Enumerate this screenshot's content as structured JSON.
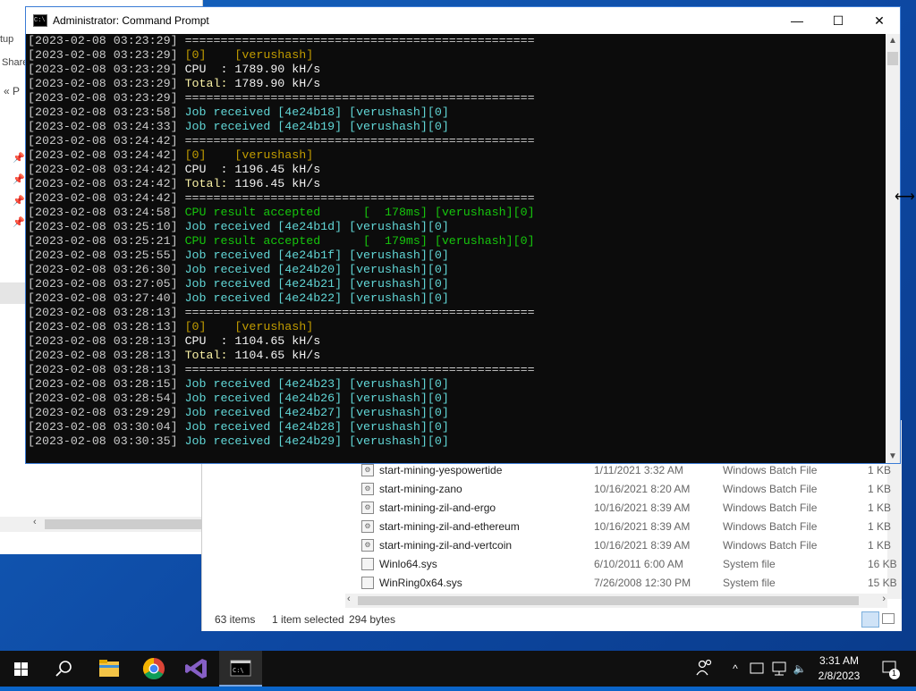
{
  "back_window": {
    "labels": [
      "tup",
      "Share",
      "P"
    ]
  },
  "cmd": {
    "title": "Administrator:  Command Prompt",
    "lines": [
      [
        {
          "t": "[2023-02-08 03:23:29] ",
          "c": "#cccccc"
        },
        {
          "t": "=================================================",
          "c": "#cccccc"
        }
      ],
      [
        {
          "t": "[2023-02-08 03:23:29] ",
          "c": "#cccccc"
        },
        {
          "t": "[0]    [verushash]",
          "c": "#c19c00"
        }
      ],
      [
        {
          "t": "[2023-02-08 03:23:29] ",
          "c": "#cccccc"
        },
        {
          "t": "CPU  : 1789.90 kH/s",
          "c": "#f2f2f2"
        }
      ],
      [
        {
          "t": "[2023-02-08 03:23:29] ",
          "c": "#cccccc"
        },
        {
          "t": "Total: ",
          "c": "#f9f1a5"
        },
        {
          "t": "1789.90 kH/s",
          "c": "#f2f2f2"
        }
      ],
      [
        {
          "t": "[2023-02-08 03:23:29] ",
          "c": "#cccccc"
        },
        {
          "t": "=================================================",
          "c": "#cccccc"
        }
      ],
      [
        {
          "t": "[2023-02-08 03:23:58] ",
          "c": "#cccccc"
        },
        {
          "t": "Job received [4e24b18] [verushash][0]",
          "c": "#61d6d6"
        }
      ],
      [
        {
          "t": "[2023-02-08 03:24:33] ",
          "c": "#cccccc"
        },
        {
          "t": "Job received [4e24b19] [verushash][0]",
          "c": "#61d6d6"
        }
      ],
      [
        {
          "t": "[2023-02-08 03:24:42] ",
          "c": "#cccccc"
        },
        {
          "t": "=================================================",
          "c": "#cccccc"
        }
      ],
      [
        {
          "t": "[2023-02-08 03:24:42] ",
          "c": "#cccccc"
        },
        {
          "t": "[0]    [verushash]",
          "c": "#c19c00"
        }
      ],
      [
        {
          "t": "[2023-02-08 03:24:42] ",
          "c": "#cccccc"
        },
        {
          "t": "CPU  : 1196.45 kH/s",
          "c": "#f2f2f2"
        }
      ],
      [
        {
          "t": "[2023-02-08 03:24:42] ",
          "c": "#cccccc"
        },
        {
          "t": "Total: ",
          "c": "#f9f1a5"
        },
        {
          "t": "1196.45 kH/s",
          "c": "#f2f2f2"
        }
      ],
      [
        {
          "t": "[2023-02-08 03:24:42] ",
          "c": "#cccccc"
        },
        {
          "t": "=================================================",
          "c": "#cccccc"
        }
      ],
      [
        {
          "t": "[2023-02-08 03:24:58] ",
          "c": "#cccccc"
        },
        {
          "t": "CPU result accepted      [  178ms] [verushash][0]",
          "c": "#16c60c"
        }
      ],
      [
        {
          "t": "[2023-02-08 03:25:10] ",
          "c": "#cccccc"
        },
        {
          "t": "Job received [4e24b1d] [verushash][0]",
          "c": "#61d6d6"
        }
      ],
      [
        {
          "t": "[2023-02-08 03:25:21] ",
          "c": "#cccccc"
        },
        {
          "t": "CPU result accepted      [  179ms] [verushash][0]",
          "c": "#16c60c"
        }
      ],
      [
        {
          "t": "[2023-02-08 03:25:55] ",
          "c": "#cccccc"
        },
        {
          "t": "Job received [4e24b1f] [verushash][0]",
          "c": "#61d6d6"
        }
      ],
      [
        {
          "t": "[2023-02-08 03:26:30] ",
          "c": "#cccccc"
        },
        {
          "t": "Job received [4e24b20] [verushash][0]",
          "c": "#61d6d6"
        }
      ],
      [
        {
          "t": "[2023-02-08 03:27:05] ",
          "c": "#cccccc"
        },
        {
          "t": "Job received [4e24b21] [verushash][0]",
          "c": "#61d6d6"
        }
      ],
      [
        {
          "t": "[2023-02-08 03:27:40] ",
          "c": "#cccccc"
        },
        {
          "t": "Job received [4e24b22] [verushash][0]",
          "c": "#61d6d6"
        }
      ],
      [
        {
          "t": "[2023-02-08 03:28:13] ",
          "c": "#cccccc"
        },
        {
          "t": "=================================================",
          "c": "#cccccc"
        }
      ],
      [
        {
          "t": "[2023-02-08 03:28:13] ",
          "c": "#cccccc"
        },
        {
          "t": "[0]    [verushash]",
          "c": "#c19c00"
        }
      ],
      [
        {
          "t": "[2023-02-08 03:28:13] ",
          "c": "#cccccc"
        },
        {
          "t": "CPU  : 1104.65 kH/s",
          "c": "#f2f2f2"
        }
      ],
      [
        {
          "t": "[2023-02-08 03:28:13] ",
          "c": "#cccccc"
        },
        {
          "t": "Total: ",
          "c": "#f9f1a5"
        },
        {
          "t": "1104.65 kH/s",
          "c": "#f2f2f2"
        }
      ],
      [
        {
          "t": "[2023-02-08 03:28:13] ",
          "c": "#cccccc"
        },
        {
          "t": "=================================================",
          "c": "#cccccc"
        }
      ],
      [
        {
          "t": "[2023-02-08 03:28:15] ",
          "c": "#cccccc"
        },
        {
          "t": "Job received [4e24b23] [verushash][0]",
          "c": "#61d6d6"
        }
      ],
      [
        {
          "t": "[2023-02-08 03:28:54] ",
          "c": "#cccccc"
        },
        {
          "t": "Job received [4e24b26] [verushash][0]",
          "c": "#61d6d6"
        }
      ],
      [
        {
          "t": "[2023-02-08 03:29:29] ",
          "c": "#cccccc"
        },
        {
          "t": "Job received [4e24b27] [verushash][0]",
          "c": "#61d6d6"
        }
      ],
      [
        {
          "t": "[2023-02-08 03:30:04] ",
          "c": "#cccccc"
        },
        {
          "t": "Job received [4e24b28] [verushash][0]",
          "c": "#61d6d6"
        }
      ],
      [
        {
          "t": "[2023-02-08 03:30:35] ",
          "c": "#cccccc"
        },
        {
          "t": "Job received [4e24b29] [verushash][0]",
          "c": "#61d6d6"
        }
      ]
    ]
  },
  "explorer": {
    "files": [
      {
        "name": "start-mining-yespowertide",
        "date": "1/11/2021 3:32 AM",
        "type": "Windows Batch File",
        "size": "1 KB"
      },
      {
        "name": "start-mining-zano",
        "date": "10/16/2021 8:20 AM",
        "type": "Windows Batch File",
        "size": "1 KB"
      },
      {
        "name": "start-mining-zil-and-ergo",
        "date": "10/16/2021 8:39 AM",
        "type": "Windows Batch File",
        "size": "1 KB"
      },
      {
        "name": "start-mining-zil-and-ethereum",
        "date": "10/16/2021 8:39 AM",
        "type": "Windows Batch File",
        "size": "1 KB"
      },
      {
        "name": "start-mining-zil-and-vertcoin",
        "date": "10/16/2021 8:39 AM",
        "type": "Windows Batch File",
        "size": "1 KB"
      },
      {
        "name": "Winlo64.sys",
        "date": "6/10/2011 6:00 AM",
        "type": "System file",
        "size": "16 KB"
      },
      {
        "name": "WinRing0x64.sys",
        "date": "7/26/2008 12:30 PM",
        "type": "System file",
        "size": "15 KB"
      }
    ],
    "status": {
      "items": "63 items",
      "selected": "1 item selected",
      "bytes": "294 bytes"
    }
  },
  "taskbar": {
    "clock_time": "3:31 AM",
    "clock_date": "2/8/2023",
    "notification_count": "1"
  },
  "icons": [
    "windows-start-icon",
    "search-icon",
    "file-explorer-icon",
    "chrome-icon",
    "visual-studio-icon",
    "command-prompt-icon",
    "people-icon",
    "chevron-up-icon",
    "network-icon",
    "volume-icon",
    "notification-icon"
  ]
}
